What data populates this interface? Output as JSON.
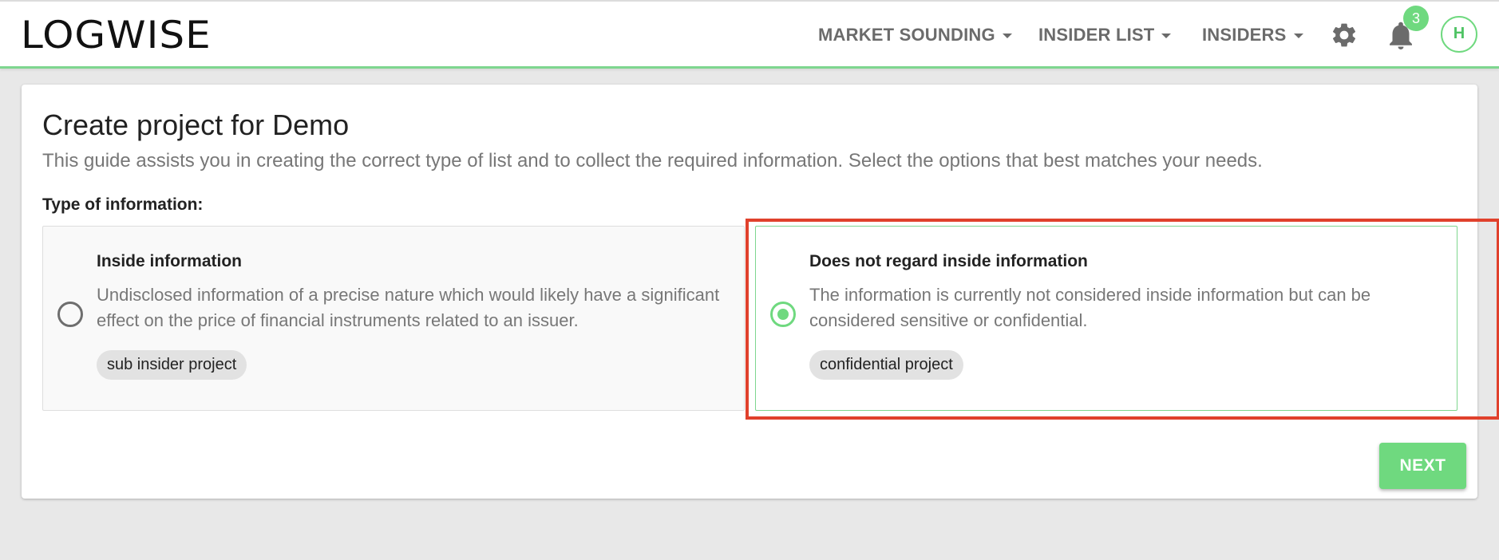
{
  "header": {
    "logo_text": "LOGWISE",
    "nav": [
      {
        "label": "MARKET SOUNDING"
      },
      {
        "label": "INSIDER LIST"
      },
      {
        "label": "INSIDERS"
      }
    ],
    "settings_icon": "gear-icon",
    "notifications_icon": "bell-icon",
    "notification_count": "3",
    "avatar_initial": "H",
    "accent_color": "#6fd97f"
  },
  "main": {
    "title": "Create project for Demo",
    "subtitle": "This guide assists you in creating the correct type of list and to collect the required information. Select the options that best matches your needs.",
    "section_label": "Type of information:",
    "options": [
      {
        "title": "Inside information",
        "description": "Undisclosed information of a precise nature which would likely have a significant effect on the price of financial instruments related to an issuer.",
        "chip": "sub insider project",
        "selected": false
      },
      {
        "title": "Does not regard inside information",
        "description": "The information is currently not considered inside information but can be considered sensitive or confidential.",
        "chip": "confidential project",
        "selected": true
      }
    ],
    "next_label": "NEXT",
    "highlight_color": "#e0412c"
  }
}
